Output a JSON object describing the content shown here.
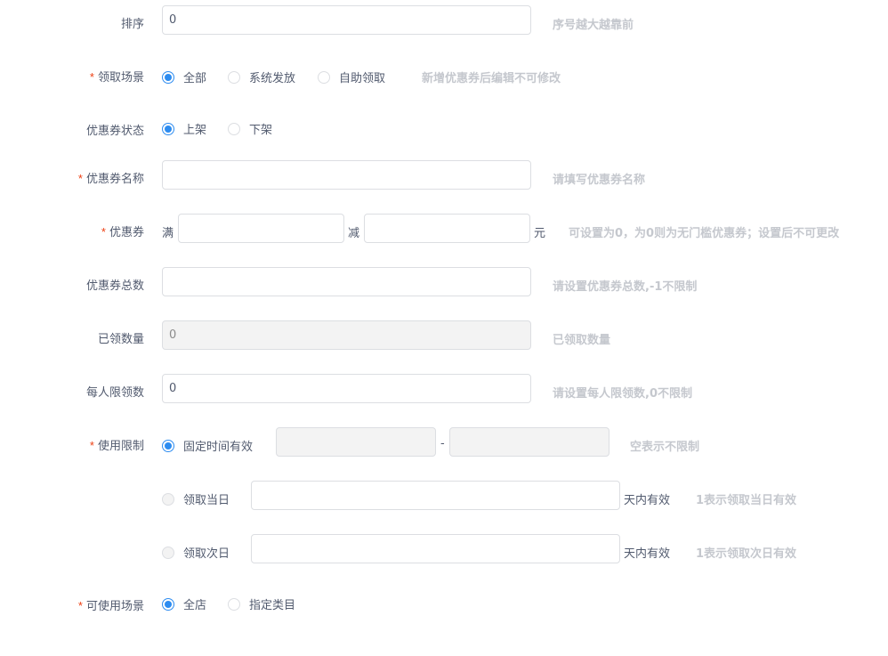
{
  "sort": {
    "label": "排序",
    "value": "0",
    "hint": "序号越大越靠前"
  },
  "receive_scene": {
    "label": "领取场景",
    "options": [
      "全部",
      "系统发放",
      "自助领取"
    ],
    "selected": "全部",
    "hint": "新增优惠券后编辑不可修改"
  },
  "coupon_status": {
    "label": "优惠券状态",
    "options": [
      "上架",
      "下架"
    ],
    "selected": "上架"
  },
  "coupon_name": {
    "label": "优惠券名称",
    "value": "",
    "placeholder": "",
    "hint": "请填写优惠券名称"
  },
  "coupon": {
    "label": "优惠券",
    "full_label": "满",
    "minus_label": "减",
    "unit": "元",
    "full_value": "",
    "minus_value": "",
    "hint": "可设置为0，为0则为无门槛优惠券；设置后不可更改"
  },
  "coupon_total": {
    "label": "优惠券总数",
    "value": "",
    "hint": "请设置优惠券总数,-1不限制"
  },
  "received_count": {
    "label": "已领数量",
    "value": "0",
    "hint": "已领取数量"
  },
  "per_person_limit": {
    "label": "每人限领数",
    "value": "0",
    "hint": "请设置每人限领数,0不限制"
  },
  "usage_limit": {
    "label": "使用限制",
    "fixed_time": {
      "label": "固定时间有效",
      "start": "",
      "end": "",
      "separator": "-",
      "hint": "空表示不限制"
    },
    "same_day": {
      "label": "领取当日",
      "value": "",
      "suffix": "天内有效",
      "hint": "1表示领取当日有效"
    },
    "next_day": {
      "label": "领取次日",
      "value": "",
      "suffix": "天内有效",
      "hint": "1表示领取次日有效"
    },
    "selected": "固定时间有效"
  },
  "usable_scene": {
    "label": "可使用场景",
    "options": [
      "全店",
      "指定类目"
    ],
    "selected": "全店"
  },
  "required_mark": "*",
  "colors": {
    "primary": "#2d8cf0",
    "required": "#ed4014",
    "hint": "#c5c8ce",
    "border": "#dcdee2"
  }
}
